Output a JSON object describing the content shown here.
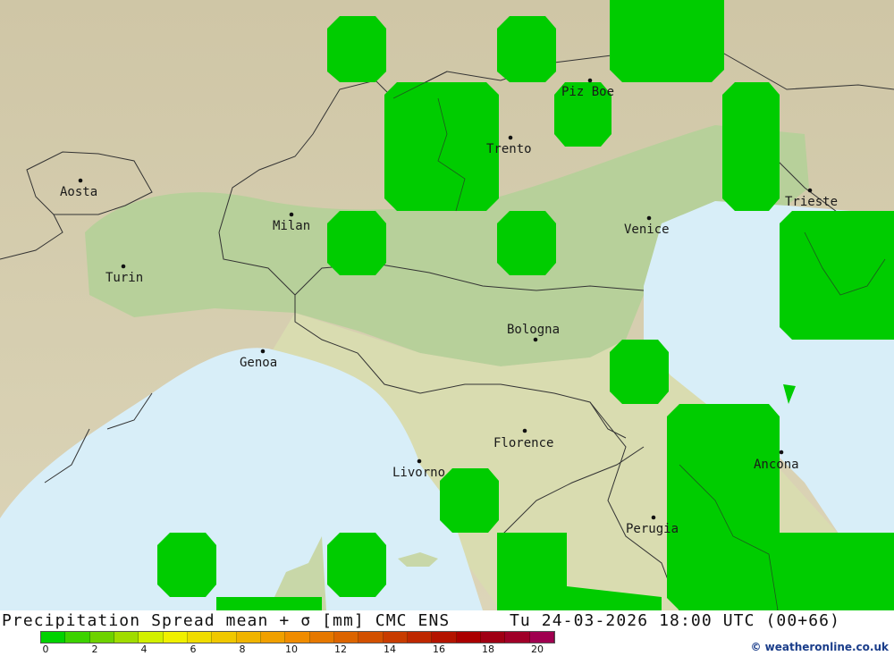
{
  "map": {
    "cities": [
      {
        "name": "Aosta"
      },
      {
        "name": "Milan"
      },
      {
        "name": "Turin"
      },
      {
        "name": "Genoa"
      },
      {
        "name": "Trento"
      },
      {
        "name": "Piz Boe"
      },
      {
        "name": "Venice"
      },
      {
        "name": "Trieste"
      },
      {
        "name": "Bologna"
      },
      {
        "name": "Florence"
      },
      {
        "name": "Livorno"
      },
      {
        "name": "Ancona"
      },
      {
        "name": "Perugia"
      }
    ],
    "spread_color": "#00cc00",
    "sea_color": "#d8eef8",
    "lowland_color": "#b9d39b",
    "mountain_color": "#d6ccaa"
  },
  "footer": {
    "title": "Precipitation Spread mean + σ [mm] CMC ENS",
    "datetime": "Tu 24-03-2026 18:00 UTC (00+66)",
    "credit": "© weatheronline.co.uk"
  },
  "legend": {
    "ticks": [
      "0",
      "2",
      "4",
      "6",
      "8",
      "10",
      "12",
      "14",
      "16",
      "18",
      "20"
    ],
    "colors": [
      "#00d200",
      "#3cd200",
      "#6ed200",
      "#a0dc00",
      "#d2f000",
      "#f0f000",
      "#f0dc00",
      "#f0c800",
      "#f0b400",
      "#f0a000",
      "#f08c00",
      "#e67800",
      "#dc6400",
      "#d25000",
      "#c83c00",
      "#be2800",
      "#b41400",
      "#aa0000",
      "#a00014",
      "#a00028",
      "#a00050"
    ]
  }
}
